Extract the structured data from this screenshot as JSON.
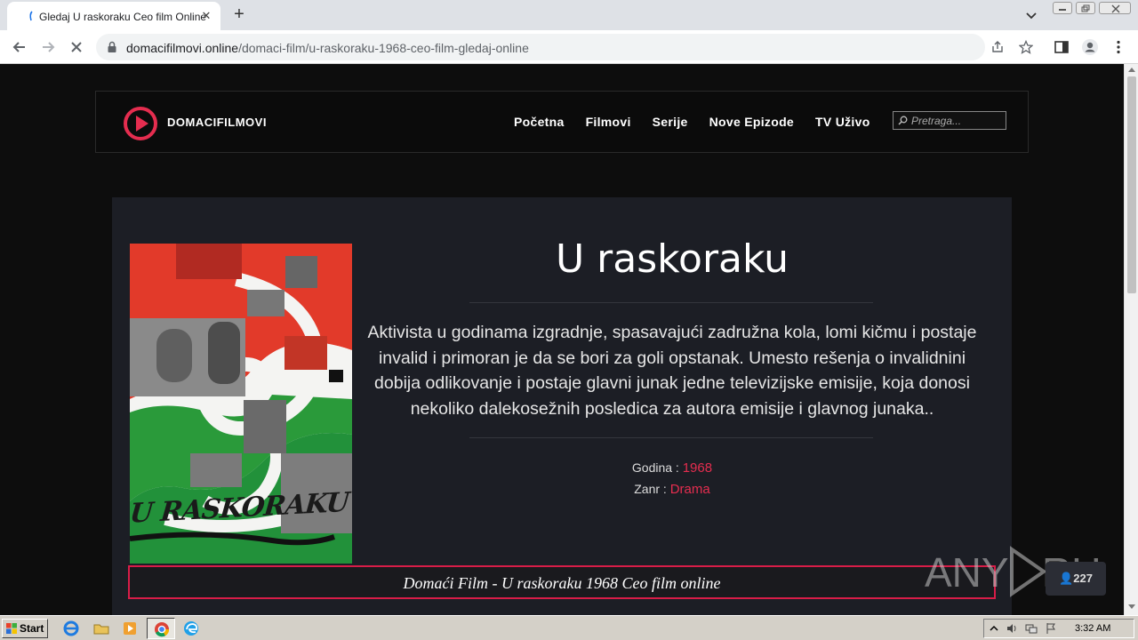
{
  "browser": {
    "tab": {
      "title": "Gledaj U raskoraku Ceo film Online"
    },
    "address": {
      "domain": "domacifilmovi.online",
      "path": "/domaci-film/u-raskoraku-1968-ceo-film-gledaj-online"
    }
  },
  "site": {
    "logo_text": "DOMACIFILMOVI",
    "menu": [
      "Početna",
      "Filmovi",
      "Serije",
      "Nove Epizode",
      "TV Uživo"
    ],
    "search_placeholder": "Pretraga..."
  },
  "movie": {
    "title": "U raskoraku",
    "poster_title": "U RASKORAKU",
    "description": "Aktivista u godinama izgradnje, spasavajući zadružna kola, lomi kičmu i postaje invalid i primoran je da se bori za goli opstanak. Umesto rešenja o invalidnini dobija odlikovanje i postaje glavni junak jedne televizijske emisije, koja donosi nekoliko dalekosežnih posledica za autora emisije i glavnog junaka..",
    "year_label": "Godina :",
    "year": "1968",
    "genre_label": "Zanr :",
    "genre": "Drama",
    "banner": "Domaći Film - U raskoraku 1968 Ceo film online"
  },
  "overlay": {
    "watermark": "ANY RUN",
    "counter": "227"
  },
  "taskbar": {
    "start_label": "Start",
    "clock": "3:32 AM"
  },
  "colors": {
    "accent": "#e52d4f",
    "banner_border": "#d81d48",
    "page_bg": "#0d0d0d",
    "panel_bg": "#1c1e25"
  }
}
